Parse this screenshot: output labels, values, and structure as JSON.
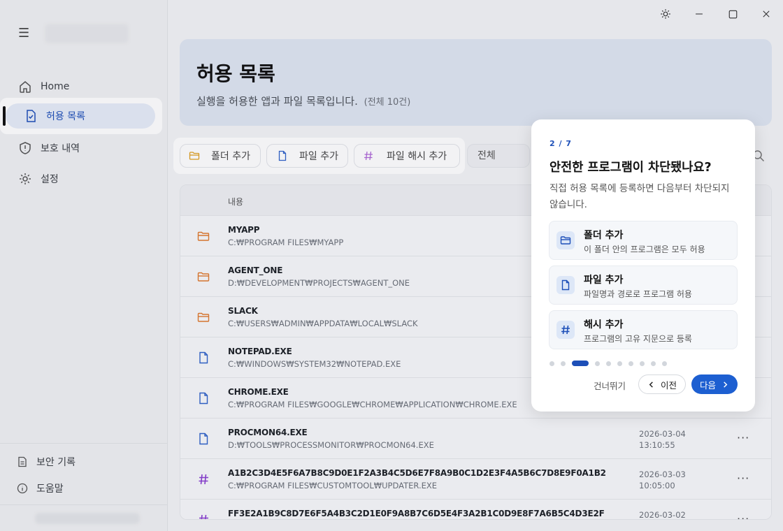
{
  "window": {
    "theme_icon": "sun-icon",
    "minimize_icon": "minimize-icon",
    "maximize_icon": "maximize-icon",
    "close_icon": "close-icon"
  },
  "sidebar": {
    "items": [
      {
        "label": "Home",
        "icon": "home-icon"
      },
      {
        "label": "허용 목록",
        "icon": "file-check-icon",
        "active": true
      },
      {
        "label": "보호 내역",
        "icon": "shield-icon"
      },
      {
        "label": "설정",
        "icon": "gear-icon"
      }
    ],
    "bottom": [
      {
        "label": "보안 기록",
        "icon": "document-icon"
      },
      {
        "label": "도움말",
        "icon": "info-icon"
      }
    ]
  },
  "header": {
    "title": "허용 목록",
    "subtitle": "실행을 허용한 앱과 파일 목록입니다.",
    "count": "(전체 10건)"
  },
  "toolbar": {
    "add_folder": "폴더 추가",
    "add_file": "파일 추가",
    "add_hash": "파일 해시 추가",
    "filter_value": "전체"
  },
  "table": {
    "column_content": "내용",
    "rows": [
      {
        "type": "folder",
        "name": "MYAPP",
        "path": "C:₩PROGRAM FILES₩MYAPP",
        "date": "",
        "time": ""
      },
      {
        "type": "folder",
        "name": "AGENT_ONE",
        "path": "D:₩DEVELOPMENT₩PROJECTS₩AGENT_ONE",
        "date": "",
        "time": ""
      },
      {
        "type": "folder",
        "name": "SLACK",
        "path": "C:₩USERS₩ADMIN₩APPDATA₩LOCAL₩SLACK",
        "date": "",
        "time": ""
      },
      {
        "type": "file",
        "name": "NOTEPAD.EXE",
        "path": "C:₩WINDOWS₩SYSTEM32₩NOTEPAD.EXE",
        "date": "",
        "time": ""
      },
      {
        "type": "file",
        "name": "CHROME.EXE",
        "path": "C:₩PROGRAM FILES₩GOOGLE₩CHROME₩APPLICATION₩CHROME.EXE",
        "date": "",
        "time": ""
      },
      {
        "type": "file",
        "name": "PROCMON64.EXE",
        "path": "D:₩TOOLS₩PROCESSMONITOR₩PROCMON64.EXE",
        "date": "2026-03-04",
        "time": "13:10:55"
      },
      {
        "type": "hash",
        "name": "A1B2C3D4E5F6A7B8C9D0E1F2A3B4C5D6E7F8A9B0C1D2E3F4A5B6C7D8E9F0A1B2",
        "path": "C:₩PROGRAM FILES₩CUSTOMTOOL₩UPDATER.EXE",
        "date": "2026-03-03",
        "time": "10:05:00"
      },
      {
        "type": "hash",
        "name": "FF3E2A1B9C8D7E6F5A4B3C2D1E0F9A8B7C6D5E4F3A2B1C0D9E8F7A6B5C4D3E2F",
        "path": "",
        "date": "2026-03-02",
        "time": ""
      }
    ],
    "more_label": "···"
  },
  "tour": {
    "step": "2 / 7",
    "title": "안전한 프로그램이 차단됐나요?",
    "desc": "직접 허용 목록에 등록하면 다음부터 차단되지 않습니다.",
    "features": [
      {
        "title": "폴더 추가",
        "desc": "이 폴더 안의 프로그램은 모두 허용",
        "icon": "folder-icon"
      },
      {
        "title": "파일 추가",
        "desc": "파일명과 경로로 프로그램 허용",
        "icon": "file-icon"
      },
      {
        "title": "해시 추가",
        "desc": "프로그램의 고유 지문으로 등록",
        "icon": "hash-icon"
      }
    ],
    "total_steps": 10,
    "current_dot": 2,
    "skip": "건너뛰기",
    "prev": "이전",
    "next": "다음"
  },
  "colors": {
    "accent": "#1d5fd1",
    "folder": "#e07a2e",
    "file": "#2f62c9",
    "hash": "#8a3fd1"
  }
}
